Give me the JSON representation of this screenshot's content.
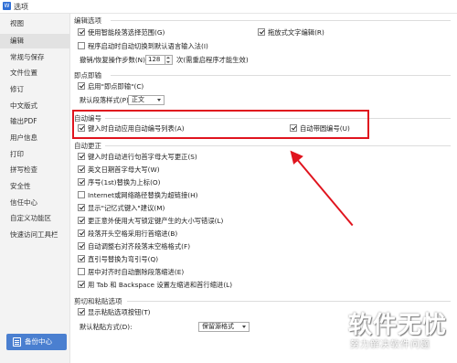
{
  "window": {
    "title": "选项",
    "app_icon_text": "W"
  },
  "sidebar": {
    "items": [
      {
        "label": "视图"
      },
      {
        "label": "编辑",
        "selected": true
      },
      {
        "label": "常规与保存"
      },
      {
        "label": "文件位置"
      },
      {
        "label": "修订"
      },
      {
        "label": "中文版式"
      },
      {
        "label": "输出PDF"
      },
      {
        "label": "用户信息"
      },
      {
        "label": "打印"
      },
      {
        "label": "拼写检查"
      },
      {
        "label": "安全性"
      },
      {
        "label": "信任中心"
      },
      {
        "label": "自定义功能区"
      },
      {
        "label": "快速访问工具栏"
      }
    ],
    "backup_button": "备份中心"
  },
  "editing": {
    "section_title": "编辑选项",
    "smart_select": {
      "label": "使用智能段落选择范围(G)",
      "checked": true
    },
    "drag_text": {
      "label": "拖放式文字编辑(R)",
      "checked": true
    },
    "auto_switch_ime": {
      "label": "程序启动时自动切换到默认语言输入法(I)",
      "checked": false
    },
    "undo_steps_label": "撤销/恢复操作步数(N):",
    "undo_steps_value": "128",
    "undo_steps_hint": "次(需重启程序才能生效)"
  },
  "click_type": {
    "section_title": "即点即输",
    "enable": {
      "label": "启用\"即点即输\"(C)",
      "checked": true
    },
    "default_style_label": "默认段落样式(P):",
    "default_style_value": "正文"
  },
  "auto_number": {
    "section_title": "自动编号",
    "list_on_input": {
      "label": "键入时自动应用自动编号列表(A)",
      "checked": true
    },
    "with_parens": {
      "label": "自动带圆编号(U)",
      "checked": true
    }
  },
  "auto_correct": {
    "section_title": "自动更正",
    "items": [
      {
        "label": "键入时自动进行句首字母大写更正(S)",
        "checked": true
      },
      {
        "label": "英文日期首字母大写(W)",
        "checked": true
      },
      {
        "label": "序号(1st)替换为上标(O)",
        "checked": true
      },
      {
        "label": "Internet或网络路径替换为超链接(H)",
        "checked": false
      },
      {
        "label": "显示\"记忆式键入\"建议(M)",
        "checked": true
      },
      {
        "label": "更正意外使用大写锁定键产生的大小写错误(L)",
        "checked": true
      },
      {
        "label": "段落开头空格采用行首缩进(B)",
        "checked": true
      },
      {
        "label": "自动调整右对齐段落末空格格式(F)",
        "checked": true
      },
      {
        "label": "直引号替换为弯引号(Q)",
        "checked": true
      },
      {
        "label": "居中对齐时自动删除段落缩进(E)",
        "checked": false
      },
      {
        "label": "用 Tab 和 Backspace 设置左缩进和首行缩进(L)",
        "checked": true
      }
    ]
  },
  "cut_paste": {
    "section_title": "剪切和粘贴选项",
    "show_paste_button": {
      "label": "显示粘贴选项按钮(T)",
      "checked": true
    },
    "default_paste_label": "默认粘贴方式(D):",
    "default_paste_value": "保留源格式"
  },
  "watermark": {
    "title": "软件无忧",
    "subtitle": "努力解决软件问题"
  },
  "colors": {
    "highlight": "#e0141e",
    "accent": "#4a7fd0"
  }
}
